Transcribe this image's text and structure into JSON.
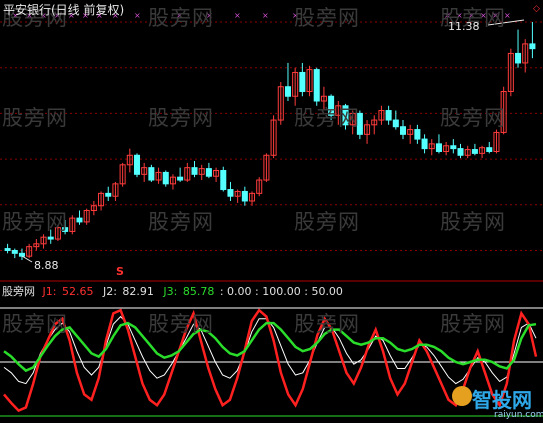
{
  "stock_title": "平安银行(日线 前复权)",
  "price_high_label": "11.38",
  "price_low_label": "8.88",
  "signal_marker": "S",
  "top_right_marker": "◇",
  "indicator": {
    "name": "股旁网",
    "j1_label": "J1:",
    "j1_value": "52.65",
    "j2_label": "J2:",
    "j2_value": "82.91",
    "j3_label": "J3:",
    "j3_value": "85.78",
    "levels_text": ": 0.00 : 100.00 : 50.00"
  },
  "watermarks": [
    "股旁网",
    "股旁网",
    "股旁网",
    "股旁网",
    "股旁网",
    "股旁网",
    "股旁网",
    "股旁网",
    "股旁网",
    "股旁网",
    "股旁网",
    "股旁网"
  ],
  "logo": {
    "main": "智投网",
    "sub": "raiyun.com"
  },
  "colors": {
    "background": "#000000",
    "up_candle": "#ff3c3c",
    "down_candle": "#54ffff",
    "grid": "#8b0000",
    "j1": "#ff2020",
    "j2": "#ffffff",
    "j3": "#2bdd2b",
    "level_0": "#2bdd2b",
    "level_100": "#ffffff",
    "level_50": "#ffffff",
    "marker": "#d050d0"
  },
  "price_levels": [
    11.38,
    10.9,
    10.42,
    9.94,
    9.46,
    8.98,
    8.88
  ],
  "candles_seed": [
    [
      9.0,
      9.05,
      8.95,
      8.98
    ],
    [
      8.98,
      9.0,
      8.9,
      8.95
    ],
    [
      8.95,
      9.0,
      8.88,
      8.92
    ],
    [
      8.92,
      9.05,
      8.9,
      9.02
    ],
    [
      9.02,
      9.1,
      8.98,
      9.05
    ],
    [
      9.05,
      9.15,
      9.0,
      9.12
    ],
    [
      9.12,
      9.2,
      9.05,
      9.1
    ],
    [
      9.1,
      9.25,
      9.08,
      9.22
    ],
    [
      9.22,
      9.3,
      9.15,
      9.18
    ],
    [
      9.18,
      9.35,
      9.15,
      9.32
    ],
    [
      9.32,
      9.4,
      9.25,
      9.28
    ],
    [
      9.28,
      9.42,
      9.25,
      9.4
    ],
    [
      9.4,
      9.5,
      9.35,
      9.45
    ],
    [
      9.45,
      9.6,
      9.4,
      9.58
    ],
    [
      9.58,
      9.65,
      9.5,
      9.55
    ],
    [
      9.55,
      9.7,
      9.5,
      9.68
    ],
    [
      9.68,
      9.9,
      9.65,
      9.88
    ],
    [
      9.88,
      10.05,
      9.8,
      9.98
    ],
    [
      9.98,
      10.0,
      9.75,
      9.78
    ],
    [
      9.78,
      9.9,
      9.7,
      9.85
    ],
    [
      9.85,
      9.88,
      9.7,
      9.72
    ],
    [
      9.72,
      9.85,
      9.68,
      9.8
    ],
    [
      9.8,
      9.82,
      9.65,
      9.68
    ],
    [
      9.68,
      9.78,
      9.62,
      9.75
    ],
    [
      9.75,
      9.85,
      9.7,
      9.72
    ],
    [
      9.72,
      9.9,
      9.7,
      9.85
    ],
    [
      9.85,
      9.92,
      9.75,
      9.78
    ],
    [
      9.78,
      9.88,
      9.72,
      9.84
    ],
    [
      9.84,
      9.9,
      9.74,
      9.76
    ],
    [
      9.76,
      9.85,
      9.7,
      9.82
    ],
    [
      9.82,
      9.86,
      9.6,
      9.62
    ],
    [
      9.62,
      9.7,
      9.5,
      9.55
    ],
    [
      9.55,
      9.62,
      9.48,
      9.6
    ],
    [
      9.6,
      9.65,
      9.45,
      9.5
    ],
    [
      9.5,
      9.6,
      9.45,
      9.58
    ],
    [
      9.58,
      9.75,
      9.55,
      9.72
    ],
    [
      9.72,
      10.0,
      9.7,
      9.98
    ],
    [
      9.98,
      10.4,
      9.95,
      10.35
    ],
    [
      10.35,
      10.75,
      10.3,
      10.7
    ],
    [
      10.7,
      10.95,
      10.55,
      10.6
    ],
    [
      10.6,
      10.9,
      10.5,
      10.85
    ],
    [
      10.85,
      10.95,
      10.6,
      10.65
    ],
    [
      10.65,
      10.92,
      10.6,
      10.88
    ],
    [
      10.88,
      10.9,
      10.5,
      10.55
    ],
    [
      10.55,
      10.7,
      10.45,
      10.6
    ],
    [
      10.6,
      10.62,
      10.35,
      10.4
    ],
    [
      10.4,
      10.55,
      10.3,
      10.5
    ],
    [
      10.5,
      10.52,
      10.25,
      10.3
    ],
    [
      10.3,
      10.45,
      10.2,
      10.42
    ],
    [
      10.42,
      10.45,
      10.15,
      10.2
    ],
    [
      10.2,
      10.35,
      10.1,
      10.3
    ],
    [
      10.3,
      10.4,
      10.2,
      10.35
    ],
    [
      10.35,
      10.5,
      10.3,
      10.45
    ],
    [
      10.45,
      10.5,
      10.3,
      10.35
    ],
    [
      10.35,
      10.45,
      10.25,
      10.28
    ],
    [
      10.28,
      10.35,
      10.15,
      10.2
    ],
    [
      10.2,
      10.3,
      10.1,
      10.25
    ],
    [
      10.25,
      10.3,
      10.1,
      10.15
    ],
    [
      10.15,
      10.2,
      10.0,
      10.05
    ],
    [
      10.05,
      10.15,
      9.98,
      10.1
    ],
    [
      10.1,
      10.2,
      10.0,
      10.02
    ],
    [
      10.02,
      10.12,
      9.98,
      10.08
    ],
    [
      10.08,
      10.15,
      10.0,
      10.05
    ],
    [
      10.05,
      10.1,
      9.95,
      9.98
    ],
    [
      9.98,
      10.08,
      9.95,
      10.04
    ],
    [
      10.04,
      10.1,
      9.98,
      10.0
    ],
    [
      10.0,
      10.08,
      9.95,
      10.06
    ],
    [
      10.06,
      10.12,
      10.0,
      10.02
    ],
    [
      10.02,
      10.25,
      10.0,
      10.22
    ],
    [
      10.22,
      10.7,
      10.2,
      10.65
    ],
    [
      10.65,
      11.1,
      10.6,
      11.05
    ],
    [
      11.05,
      11.3,
      10.9,
      10.95
    ],
    [
      10.95,
      11.2,
      10.85,
      11.15
    ],
    [
      11.15,
      11.38,
      11.0,
      11.1
    ]
  ],
  "j1_seed": [
    20,
    12,
    5,
    8,
    30,
    55,
    70,
    85,
    90,
    70,
    40,
    20,
    15,
    35,
    70,
    95,
    98,
    80,
    55,
    30,
    15,
    10,
    20,
    40,
    60,
    80,
    95,
    70,
    45,
    25,
    10,
    15,
    35,
    60,
    88,
    98,
    92,
    70,
    40,
    20,
    10,
    25,
    50,
    75,
    90,
    80,
    60,
    40,
    30,
    45,
    65,
    80,
    60,
    35,
    20,
    30,
    50,
    70,
    60,
    45,
    30,
    15,
    10,
    25,
    45,
    60,
    40,
    20,
    10,
    30,
    70,
    95,
    85,
    55
  ],
  "j2_seed": [
    45,
    40,
    32,
    30,
    40,
    58,
    70,
    80,
    86,
    78,
    60,
    45,
    38,
    45,
    65,
    85,
    92,
    85,
    70,
    55,
    42,
    35,
    38,
    48,
    60,
    72,
    85,
    80,
    65,
    50,
    38,
    35,
    42,
    58,
    78,
    90,
    90,
    82,
    65,
    48,
    38,
    40,
    52,
    68,
    82,
    82,
    72,
    58,
    48,
    52,
    62,
    74,
    70,
    56,
    44,
    44,
    54,
    66,
    64,
    56,
    46,
    36,
    30,
    34,
    44,
    54,
    50,
    40,
    32,
    36,
    58,
    82,
    86,
    72
  ],
  "j3_seed": [
    60,
    55,
    48,
    42,
    45,
    55,
    65,
    74,
    80,
    82,
    74,
    66,
    58,
    55,
    62,
    74,
    84,
    86,
    82,
    74,
    66,
    58,
    54,
    56,
    60,
    68,
    76,
    80,
    78,
    72,
    64,
    58,
    56,
    60,
    70,
    80,
    86,
    86,
    80,
    72,
    64,
    60,
    62,
    68,
    76,
    80,
    80,
    74,
    68,
    66,
    68,
    72,
    72,
    68,
    62,
    60,
    62,
    66,
    66,
    64,
    60,
    54,
    50,
    48,
    50,
    52,
    52,
    50,
    46,
    44,
    52,
    72,
    84,
    85
  ]
}
